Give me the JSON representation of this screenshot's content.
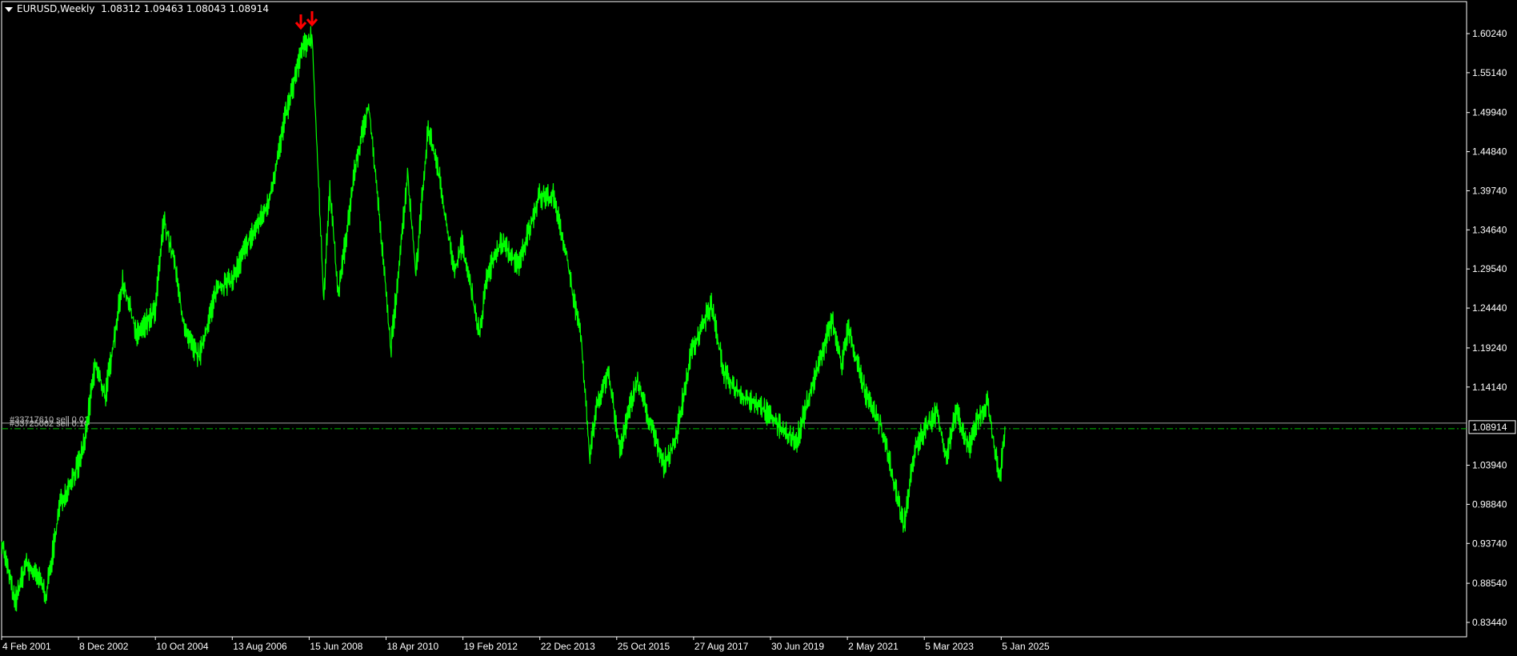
{
  "header": {
    "symbol": "EURUSD,Weekly",
    "ohlc": "1.08312 1.09463 1.08043 1.08914"
  },
  "colors": {
    "background": "#000000",
    "price_line": "#00ff00",
    "axis": "#ffffff",
    "arrow": "#ff0000",
    "order_line": "#00c000"
  },
  "chart_data": {
    "type": "line",
    "y_ticks": [
      "1.60240",
      "1.55140",
      "1.49940",
      "1.44840",
      "1.39740",
      "1.34640",
      "1.29540",
      "1.24440",
      "1.19240",
      "1.14140",
      "1.08914",
      "1.03940",
      "0.98840",
      "0.93740",
      "0.88540",
      "0.83440"
    ],
    "x_ticks": [
      "4 Feb 2001",
      "8 Dec 2002",
      "10 Oct 2004",
      "13 Aug 2006",
      "15 Jun 2008",
      "18 Apr 2010",
      "19 Feb 2012",
      "22 Dec 2013",
      "25 Oct 2015",
      "27 Aug 2017",
      "30 Jun 2019",
      "2 May 2021",
      "5 Mar 2023",
      "5 Jan 2025"
    ],
    "ylim": [
      0.83,
      1.64
    ],
    "current_price": "1.08914",
    "orders": [
      "#33717610 sell 0.01",
      "#33725062 sell 0.10"
    ],
    "series": [
      {
        "x": [
          "2001-02-04",
          "2001-06-01",
          "2001-09-01",
          "2002-01-01",
          "2002-03-01",
          "2002-07-01",
          "2002-12-08",
          "2003-02-01",
          "2003-05-01",
          "2003-08-01",
          "2004-01-01",
          "2004-05-01",
          "2004-10-10",
          "2004-12-25",
          "2005-04-01",
          "2005-07-01",
          "2005-11-01",
          "2006-04-01",
          "2006-08-13",
          "2007-01-01",
          "2007-07-01",
          "2007-11-20",
          "2008-04-15",
          "2008-07-15",
          "2008-10-25",
          "2008-12-20",
          "2009-03-01",
          "2009-08-01",
          "2009-11-25",
          "2010-03-01",
          "2010-06-07",
          "2010-11-01",
          "2011-01-10",
          "2011-05-01",
          "2011-08-01",
          "2011-12-15",
          "2012-02-19",
          "2012-07-24",
          "2012-10-01",
          "2013-02-01",
          "2013-07-01",
          "2013-12-22",
          "2014-05-01",
          "2014-08-01",
          "2015-01-01",
          "2015-03-15",
          "2015-05-15",
          "2015-08-24",
          "2015-10-25",
          "2015-12-01",
          "2016-05-01",
          "2016-12-20",
          "2017-04-01",
          "2017-08-27",
          "2018-02-15",
          "2018-06-01",
          "2018-11-01",
          "2019-04-01",
          "2019-09-30",
          "2020-03-01",
          "2020-06-01",
          "2021-01-06",
          "2021-03-31",
          "2021-05-25",
          "2021-11-01",
          "2022-03-07",
          "2022-06-01",
          "2022-09-27",
          "2023-01-01",
          "2023-03-05",
          "2023-07-15",
          "2023-10-03",
          "2024-01-01",
          "2024-04-16",
          "2024-07-01",
          "2024-09-30",
          "2025-01-05",
          "2025-01-13",
          "2025-03-02"
        ],
        "y": [
          0.94,
          0.86,
          0.91,
          0.89,
          0.87,
          0.99,
          1.04,
          1.07,
          1.17,
          1.13,
          1.28,
          1.21,
          1.24,
          1.36,
          1.3,
          1.21,
          1.18,
          1.27,
          1.28,
          1.33,
          1.38,
          1.49,
          1.58,
          1.6,
          1.26,
          1.4,
          1.26,
          1.43,
          1.51,
          1.36,
          1.19,
          1.42,
          1.29,
          1.48,
          1.42,
          1.29,
          1.33,
          1.21,
          1.29,
          1.33,
          1.3,
          1.39,
          1.39,
          1.33,
          1.2,
          1.05,
          1.12,
          1.16,
          1.1,
          1.06,
          1.15,
          1.04,
          1.07,
          1.19,
          1.25,
          1.16,
          1.13,
          1.12,
          1.09,
          1.07,
          1.12,
          1.23,
          1.17,
          1.22,
          1.13,
          1.09,
          1.04,
          0.96,
          1.06,
          1.08,
          1.11,
          1.05,
          1.11,
          1.06,
          1.1,
          1.12,
          1.03,
          1.02,
          1.09
        ]
      }
    ]
  }
}
